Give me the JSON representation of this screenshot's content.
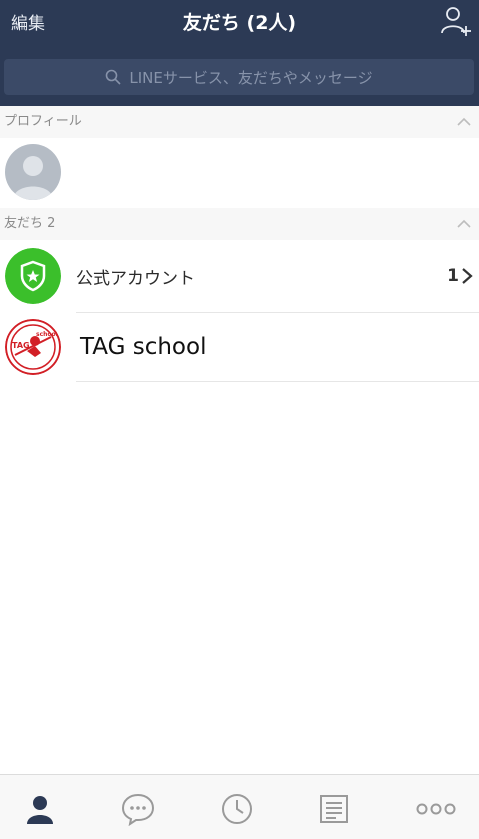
{
  "header": {
    "edit_label": "編集",
    "title": "友だち (2人)"
  },
  "search": {
    "placeholder": "LINEサービス、友だちやメッセージ"
  },
  "sections": {
    "profile_label": "プロフィール",
    "friends_label": "友だち 2"
  },
  "friends": [
    {
      "name": "公式アカウント",
      "count": "1"
    },
    {
      "name": "TAG school"
    }
  ],
  "tabs": [
    "friends",
    "chats",
    "timeline",
    "news",
    "more"
  ],
  "colors": {
    "header_bg": "#2c3a55",
    "accent_green": "#3bbf2b",
    "tab_active": "#2c3a55",
    "tab_inactive": "#9a9a9a"
  }
}
